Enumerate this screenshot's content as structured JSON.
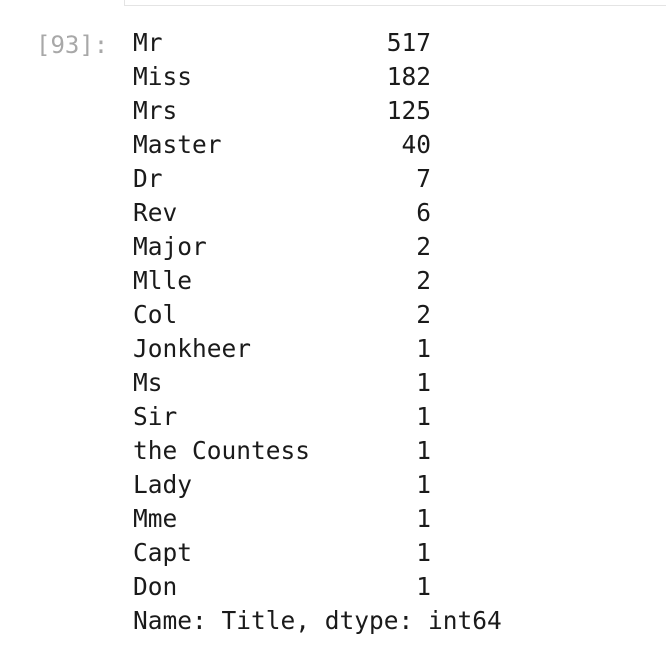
{
  "cell": {
    "prompt": "[93]:"
  },
  "series": {
    "rows": [
      {
        "label": "Mr",
        "count": "517"
      },
      {
        "label": "Miss",
        "count": "182"
      },
      {
        "label": "Mrs",
        "count": "125"
      },
      {
        "label": "Master",
        "count": "40"
      },
      {
        "label": "Dr",
        "count": "7"
      },
      {
        "label": "Rev",
        "count": "6"
      },
      {
        "label": "Major",
        "count": "2"
      },
      {
        "label": "Mlle",
        "count": "2"
      },
      {
        "label": "Col",
        "count": "2"
      },
      {
        "label": "Jonkheer",
        "count": "1"
      },
      {
        "label": "Ms",
        "count": "1"
      },
      {
        "label": "Sir",
        "count": "1"
      },
      {
        "label": "the Countess",
        "count": "1"
      },
      {
        "label": "Lady",
        "count": "1"
      },
      {
        "label": "Mme",
        "count": "1"
      },
      {
        "label": "Capt",
        "count": "1"
      },
      {
        "label": "Don",
        "count": "1"
      }
    ],
    "footer": "Name: Title, dtype: int64"
  }
}
